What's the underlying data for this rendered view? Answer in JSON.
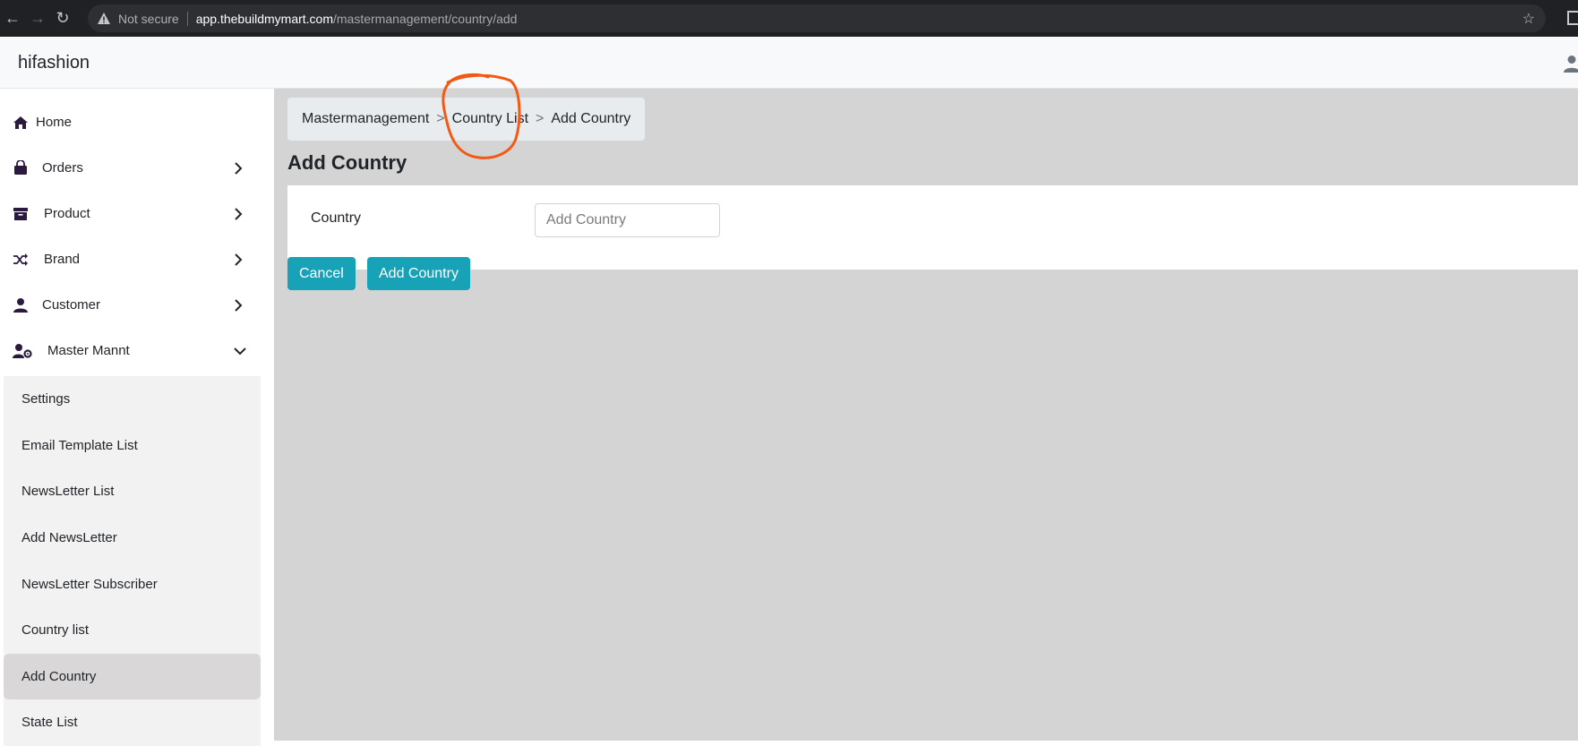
{
  "browser": {
    "not_secure": "Not secure",
    "url_host": "app.thebuildmymart.com",
    "url_path": "/mastermanagement/country/add"
  },
  "header": {
    "brand": "hifashion"
  },
  "sidebar": {
    "items": [
      {
        "label": "Home",
        "icon": "home-icon"
      },
      {
        "label": "Orders",
        "icon": "shopping-bag-icon"
      },
      {
        "label": "Product",
        "icon": "archive-box-icon"
      },
      {
        "label": "Brand",
        "icon": "shuffle-icon"
      },
      {
        "label": "Customer",
        "icon": "user-icon"
      },
      {
        "label": "Master Mannt",
        "icon": "user-gear-icon"
      }
    ],
    "submenu": [
      {
        "label": "Settings"
      },
      {
        "label": "Email Template List"
      },
      {
        "label": "NewsLetter List"
      },
      {
        "label": "Add NewsLetter"
      },
      {
        "label": "NewsLetter Subscriber"
      },
      {
        "label": "Country list"
      },
      {
        "label": "Add Country",
        "active": true
      },
      {
        "label": "State List"
      }
    ]
  },
  "breadcrumb": {
    "items": [
      "Mastermanagement",
      "Country List",
      "Add Country"
    ],
    "separator": ">"
  },
  "page": {
    "title": "Add Country"
  },
  "form": {
    "country_label": "Country",
    "country_placeholder": "Add Country",
    "country_value": ""
  },
  "actions": {
    "cancel_label": "Cancel",
    "submit_label": "Add Country"
  },
  "colors": {
    "primary_button": "#17a2b8",
    "annotation": "#f05a14",
    "sidebar_icon": "#2b1a3d"
  }
}
